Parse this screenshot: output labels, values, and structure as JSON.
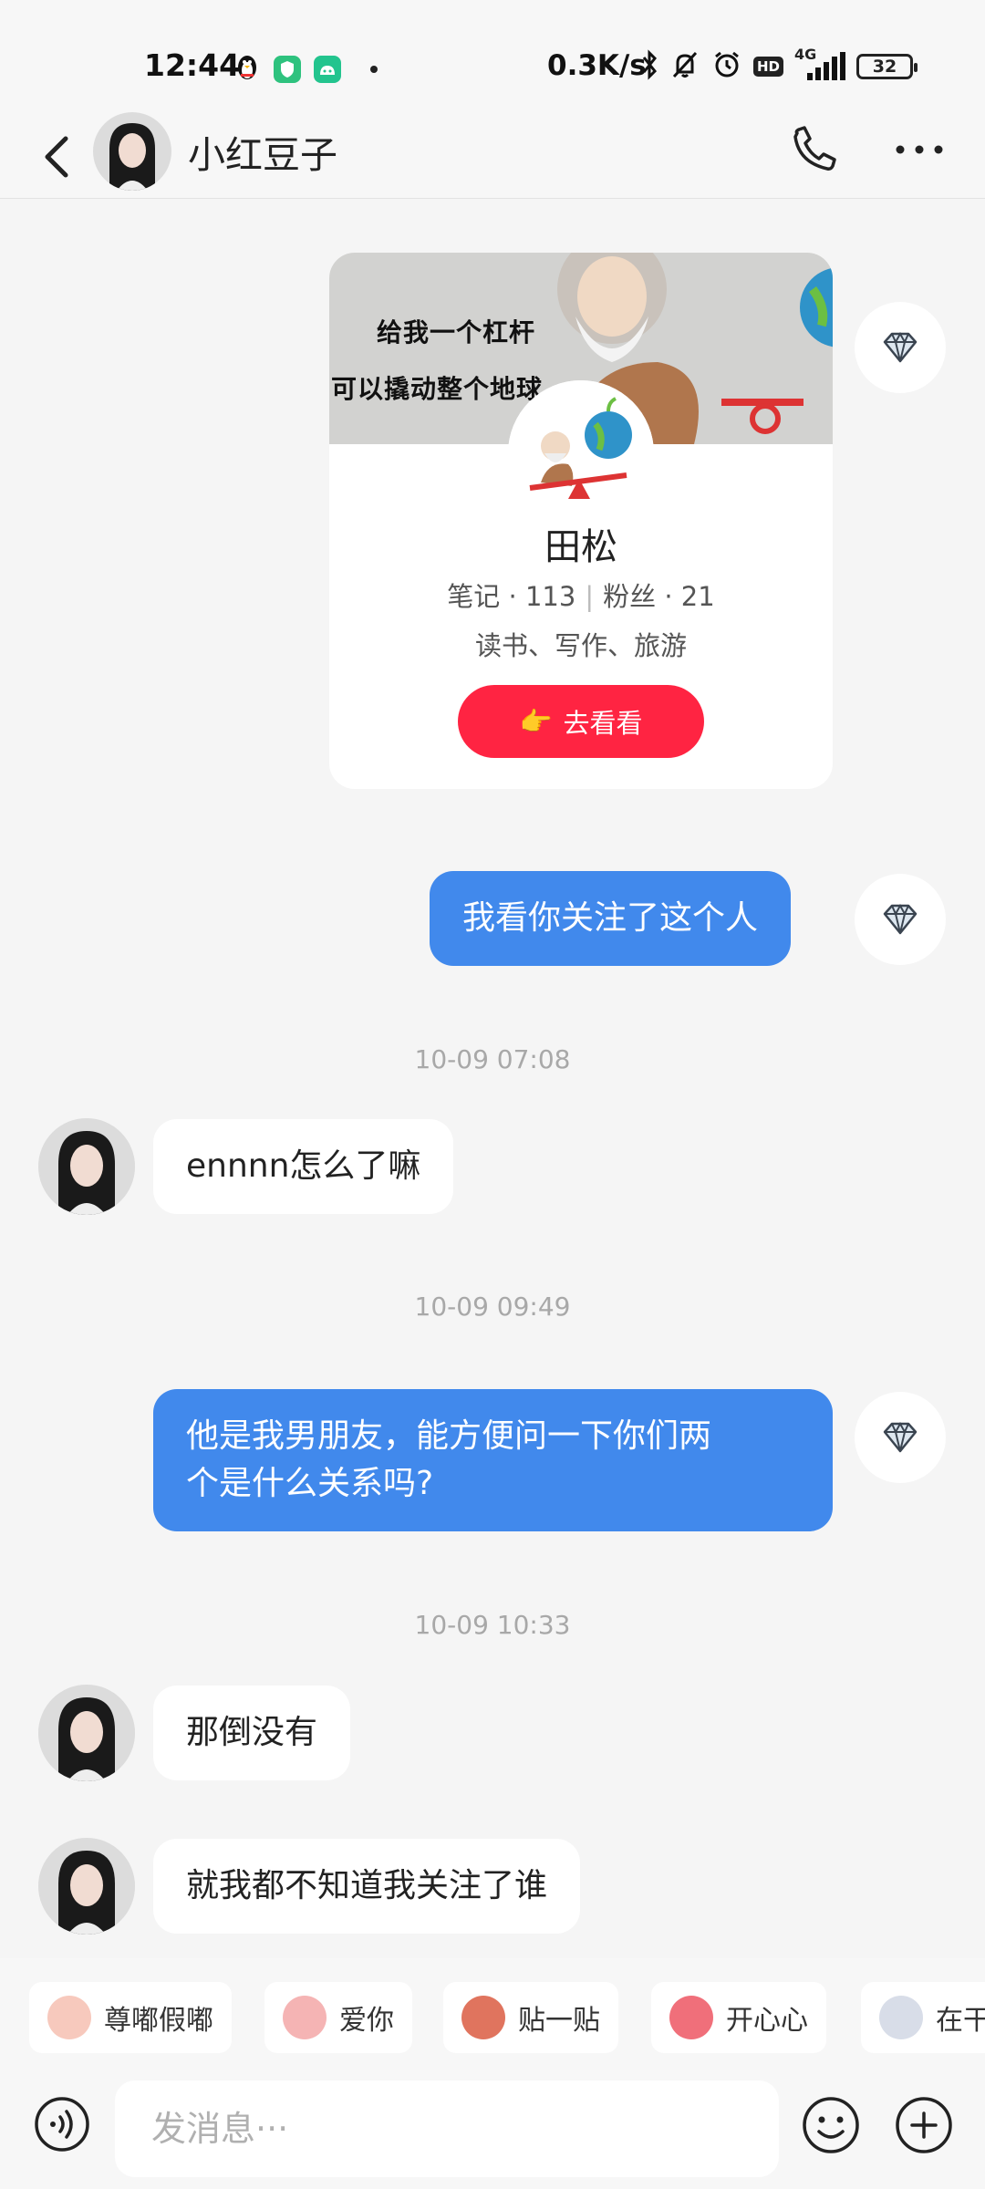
{
  "status_bar": {
    "time": "12:44",
    "net_speed": "0.3K/s",
    "network": "4G",
    "hd": "HD",
    "battery": "32"
  },
  "header": {
    "contact_name": "小红豆子"
  },
  "profile_card": {
    "banner_line1": "给我一个杠杆",
    "banner_line2": "可以撬动整个地球",
    "name": "田松",
    "notes_label": "笔记",
    "notes_count": "113",
    "fans_label": "粉丝",
    "fans_count": "21",
    "tags": "读书、写作、旅游",
    "button_label": "去看看",
    "button_icon": "👉"
  },
  "messages": [
    {
      "side": "out",
      "text": "我看你关注了这个人"
    },
    {
      "type": "time",
      "text": "10-09 07:08"
    },
    {
      "side": "in",
      "text": "ennnn怎么了嘛"
    },
    {
      "type": "time",
      "text": "10-09 09:49"
    },
    {
      "side": "out",
      "line1": "他是我男朋友，能方便问一下你们两",
      "line2": "个是什么关系吗?"
    },
    {
      "type": "time",
      "text": "10-09 10:33"
    },
    {
      "side": "in",
      "text": "那倒没有"
    },
    {
      "side": "in",
      "text": "就我都不知道我关注了谁"
    }
  ],
  "quick_replies": [
    "尊嘟假嘟",
    "爱你",
    "贴一贴",
    "开心心",
    "在干"
  ],
  "input": {
    "placeholder": "发消息···"
  },
  "colors": {
    "outgoing_bubble": "#4189ec",
    "accent_button": "#ff2442",
    "background": "#f5f5f5"
  }
}
